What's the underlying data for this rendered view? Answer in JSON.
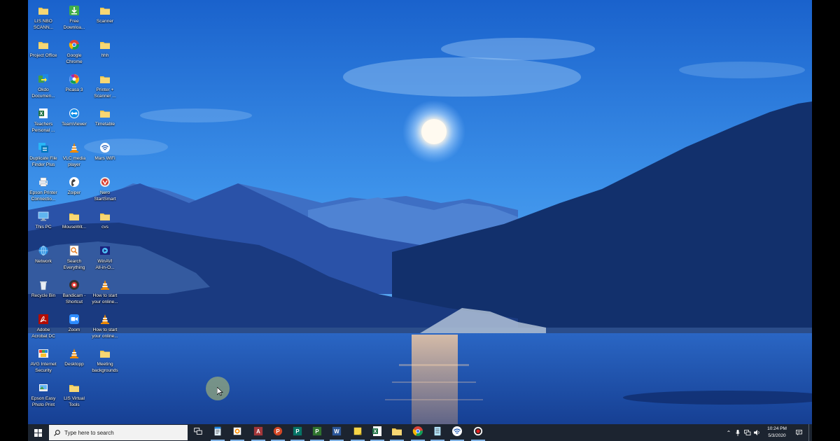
{
  "desktop": {
    "icons": [
      {
        "id": "lis-nbo-scann",
        "label": "LIS NBO\nSCANN...",
        "icon": "folder-icon"
      },
      {
        "id": "free-download",
        "label": "Free\nDownloa...",
        "icon": "free-download-manager-icon"
      },
      {
        "id": "scanner",
        "label": "Scanner",
        "icon": "folder-icon"
      },
      {
        "id": "project-office",
        "label": "Project Office",
        "icon": "folder-icon"
      },
      {
        "id": "google-chrome",
        "label": "Google\nChrome",
        "icon": "chrome-icon"
      },
      {
        "id": "hhh",
        "label": "hhh",
        "icon": "folder-icon"
      },
      {
        "id": "okdo",
        "label": "Okdo\nDocumen...",
        "icon": "okdo-converter-icon"
      },
      {
        "id": "picasa",
        "label": "Picasa 3",
        "icon": "picasa-icon"
      },
      {
        "id": "printer-scanner",
        "label": "Printer +\nScanner ...",
        "icon": "folder-icon"
      },
      {
        "id": "teachers-personal",
        "label": "Teachers\nPersonal ...",
        "icon": "excel-file-icon"
      },
      {
        "id": "teamviewer",
        "label": "TeamViewer",
        "icon": "teamviewer-icon"
      },
      {
        "id": "timetable",
        "label": "Timetable",
        "icon": "folder-icon"
      },
      {
        "id": "duplicate-file-finder",
        "label": "Duplicate File\nFinder Plus",
        "icon": "duplicate-finder-icon"
      },
      {
        "id": "vlc",
        "label": "VLC media\nplayer",
        "icon": "vlc-cone-icon"
      },
      {
        "id": "mars-wifi",
        "label": "Mars WiFi",
        "icon": "wifi-app-icon"
      },
      {
        "id": "epson-printer-connection",
        "label": "Epson Printer\nConnectio...",
        "icon": "epson-printer-icon"
      },
      {
        "id": "zoiper",
        "label": "Zoiper",
        "icon": "zoiper-icon"
      },
      {
        "id": "nero",
        "label": "Nero\nStartSmart",
        "icon": "nero-icon"
      },
      {
        "id": "this-pc",
        "label": "This PC",
        "icon": "this-pc-icon"
      },
      {
        "id": "mousewit",
        "label": "MouseWit...",
        "icon": "folder-icon"
      },
      {
        "id": "cvs",
        "label": "cvs",
        "icon": "folder-icon"
      },
      {
        "id": "network",
        "label": "Network",
        "icon": "network-icon"
      },
      {
        "id": "search-everything",
        "label": "Search\nEverything",
        "icon": "search-everything-icon"
      },
      {
        "id": "winavi",
        "label": "WinAVI\nAll-in-O...",
        "icon": "winavi-icon"
      },
      {
        "id": "recycle-bin",
        "label": "Recycle Bin",
        "icon": "recycle-bin-icon"
      },
      {
        "id": "bandicam",
        "label": "Bandicam -\nShortcut",
        "icon": "bandicam-icon"
      },
      {
        "id": "how-to-start-1",
        "label": "How to start\nyour online...",
        "icon": "vlc-cone-icon"
      },
      {
        "id": "adobe-acrobat",
        "label": "Adobe\nAcrobat DC",
        "icon": "acrobat-icon"
      },
      {
        "id": "zoom",
        "label": "Zoom",
        "icon": "zoom-icon"
      },
      {
        "id": "how-to-start-2",
        "label": "How to start\nyour online...",
        "icon": "vlc-cone-icon"
      },
      {
        "id": "avg",
        "label": "AVG Internet\nSecurity",
        "icon": "avg-icon"
      },
      {
        "id": "desktopp",
        "label": "Desktopp",
        "icon": "vlc-cone-icon"
      },
      {
        "id": "meeting-backgrounds",
        "label": "Meeting\nbackgrounds",
        "icon": "folder-icon"
      },
      {
        "id": "epson-easy-photo",
        "label": "Epson Easy\nPhoto Print",
        "icon": "epson-photo-icon"
      },
      {
        "id": "lis-virtual-tools",
        "label": "LIS Virtual\nTools",
        "icon": "folder-icon"
      }
    ]
  },
  "taskbar": {
    "search_placeholder": "Type here to search",
    "apps": [
      {
        "id": "task-view",
        "icon": "task-view-icon"
      },
      {
        "id": "notepad",
        "icon": "document-app-icon"
      },
      {
        "id": "photos",
        "icon": "photo-app-icon"
      },
      {
        "id": "access",
        "icon": "access-icon",
        "color": "#a4373a"
      },
      {
        "id": "powerpoint",
        "icon": "powerpoint-icon",
        "color": "#d24726"
      },
      {
        "id": "publisher",
        "icon": "publisher-icon",
        "color": "#077568"
      },
      {
        "id": "project",
        "icon": "project-icon",
        "color": "#31752f"
      },
      {
        "id": "word",
        "icon": "word-icon",
        "color": "#2b579a"
      },
      {
        "id": "sticky-notes",
        "icon": "sticky-notes-icon",
        "color": "#f7d547"
      },
      {
        "id": "excel",
        "icon": "excel-icon",
        "color": "#217346"
      },
      {
        "id": "file-explorer",
        "icon": "folder-icon",
        "color": "#f0c84a"
      },
      {
        "id": "chrome",
        "icon": "chrome-icon"
      },
      {
        "id": "notepad2",
        "icon": "notepad-icon"
      },
      {
        "id": "wifi-app",
        "icon": "wifi-app-icon"
      },
      {
        "id": "recorder",
        "icon": "record-icon",
        "color": "#e02020"
      }
    ],
    "clock": {
      "time": "10:24 PM",
      "date": "5/3/2020"
    }
  },
  "colors": {
    "sky_top": "#1f6fd6",
    "sky_mid": "#3f94ec",
    "water": "#1c4fa8",
    "taskbar": "#1c2430"
  }
}
